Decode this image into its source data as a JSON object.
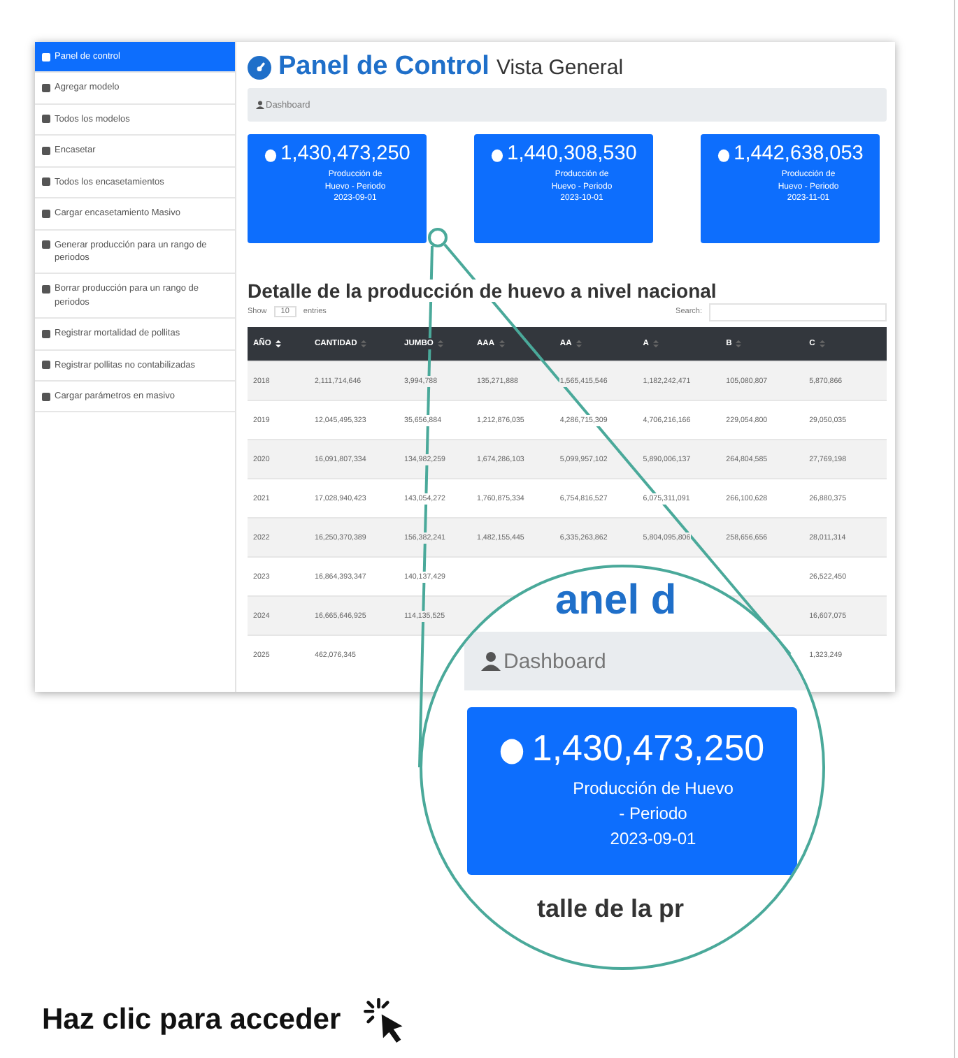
{
  "sidebar": {
    "items": [
      {
        "label": "Panel de control",
        "selected": true
      },
      {
        "label": "Agregar modelo",
        "selected": false
      },
      {
        "label": "Todos los modelos",
        "selected": false
      },
      {
        "label": "Encasetar",
        "selected": false
      },
      {
        "label": "Todos los encasetamientos",
        "selected": false
      },
      {
        "label": "Cargar encasetamiento Masivo",
        "selected": false
      },
      {
        "label": "Generar producción para un rango de periodos",
        "selected": false
      },
      {
        "label": "Borrar producción para un rango de periodos",
        "selected": false
      },
      {
        "label": "Registrar mortalidad de pollitas",
        "selected": false
      },
      {
        "label": "Registrar pollitas no contabilizadas",
        "selected": false
      },
      {
        "label": "Cargar parámetros en masivo",
        "selected": false
      }
    ]
  },
  "header": {
    "title": "Panel de Control",
    "subtitle": "Vista General"
  },
  "breadcrumb": "Dashboard",
  "cards": [
    {
      "value": "1,430,473,250",
      "caption": "Producción de Huevo - Periodo",
      "date": "2023-09-01"
    },
    {
      "value": "1,440,308,530",
      "caption": "Producción de Huevo - Periodo",
      "date": "2023-10-01"
    },
    {
      "value": "1,442,638,053",
      "caption": "Producción de Huevo - Periodo",
      "date": "2023-11-01"
    }
  ],
  "table_section": {
    "title": "Detalle de la producción de huevo a nivel nacional",
    "show_label": "Show",
    "page_size": "10",
    "entries_label": "entries",
    "search_label": "Search:",
    "columns": [
      {
        "label": "AÑO",
        "sorted": true
      },
      {
        "label": "CANTIDAD",
        "sorted": false
      },
      {
        "label": "JUMBO",
        "sorted": false
      },
      {
        "label": "AAA",
        "sorted": false
      },
      {
        "label": "AA",
        "sorted": false
      },
      {
        "label": "A",
        "sorted": false
      },
      {
        "label": "B",
        "sorted": false
      },
      {
        "label": "C",
        "sorted": false
      }
    ],
    "rows": [
      [
        "2018",
        "2,111,714,646",
        "3,994,788",
        "135,271,888",
        "1,565,415,546",
        "1,182,242,471",
        "105,080,807",
        "5,870,866"
      ],
      [
        "2019",
        "12,045,495,323",
        "35,656,884",
        "1,212,876,035",
        "4,286,715,309",
        "4,706,216,166",
        "229,054,800",
        "29,050,035"
      ],
      [
        "2020",
        "16,091,807,334",
        "134,982,259",
        "1,674,286,103",
        "5,099,957,102",
        "5,890,006,137",
        "264,804,585",
        "27,769,198"
      ],
      [
        "2021",
        "17,028,940,423",
        "143,054,272",
        "1,760,875,334",
        "6,754,816,527",
        "6,075,311,091",
        "266,100,628",
        "26,880,375"
      ],
      [
        "2022",
        "16,250,370,389",
        "156,382,241",
        "1,482,155,445",
        "6,335,263,862",
        "5,804,095,806",
        "258,656,656",
        "28,011,314"
      ],
      [
        "2023",
        "16,864,393,347",
        "140,137,429",
        null,
        null,
        null,
        null,
        "26,522,450"
      ],
      [
        "2024",
        "16,665,646,925",
        "114,135,525",
        null,
        null,
        null,
        null,
        "16,607,075"
      ],
      [
        "2025",
        "462,076,345",
        null,
        null,
        null,
        null,
        null,
        "1,323,249"
      ]
    ]
  },
  "magnifier": {
    "title_fragment": "anel d",
    "breadcrumb": "Dashboard",
    "card": {
      "value": "1,430,473,250",
      "caption": "Producción de Huevo - Periodo",
      "date": "2023-09-01"
    },
    "heading_fragment": "talle de la pr"
  },
  "call_to_action": "Haz clic para acceder"
}
